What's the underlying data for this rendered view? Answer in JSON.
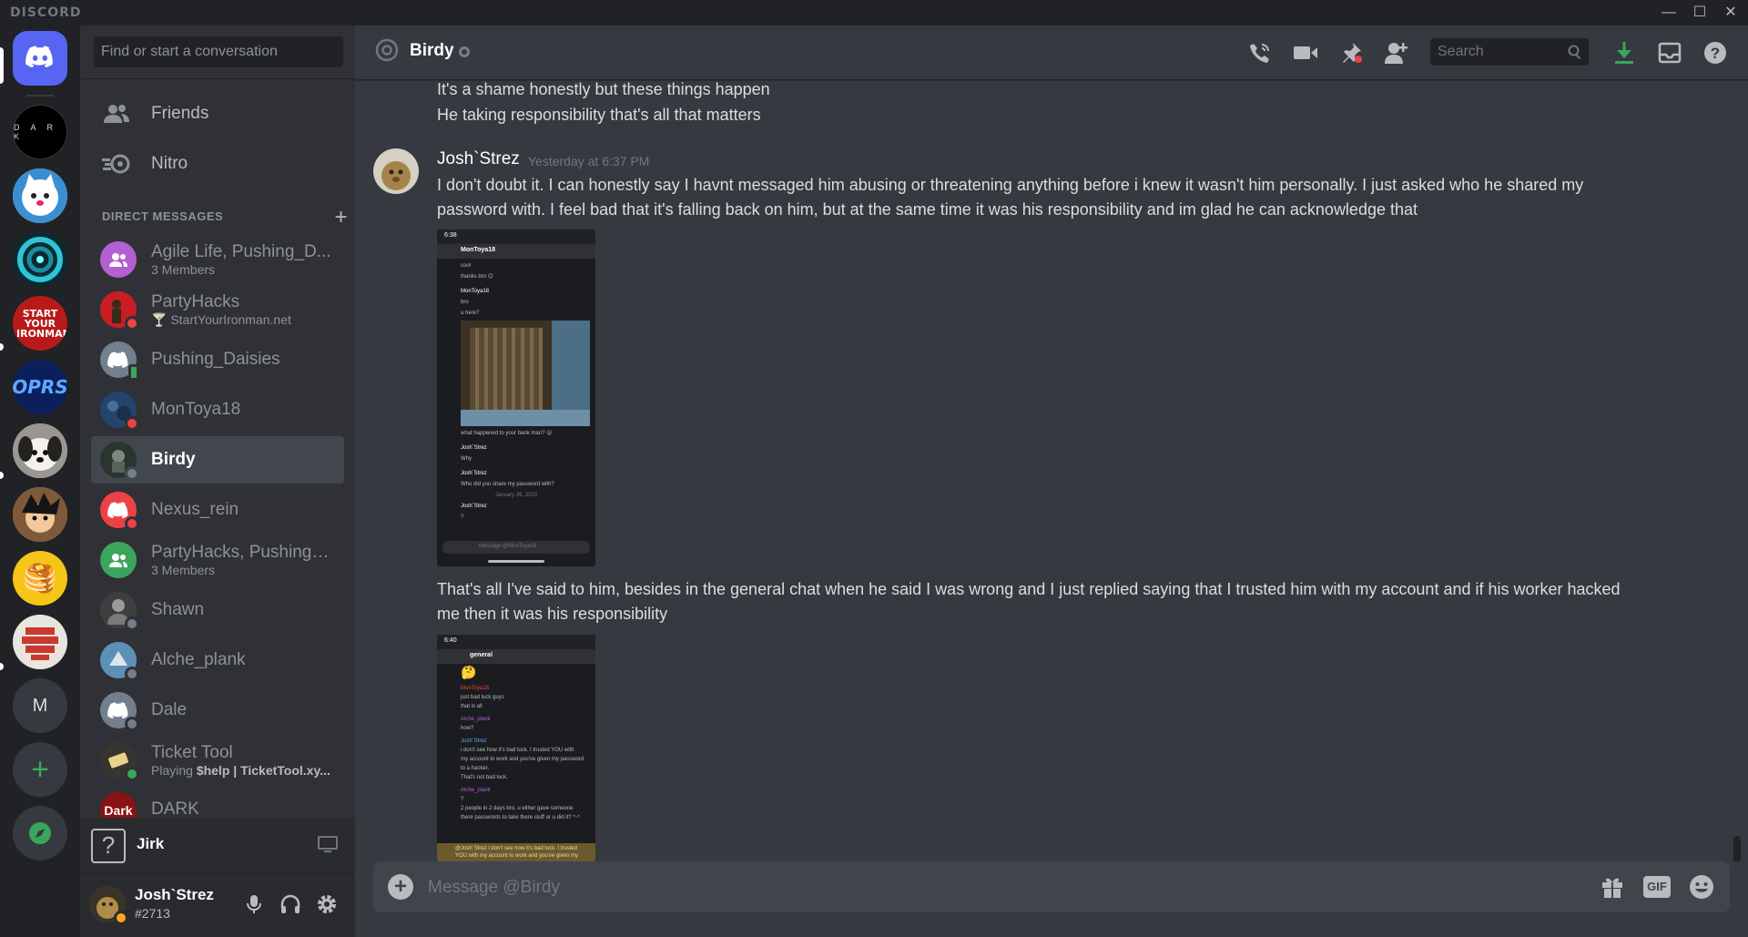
{
  "window": {
    "brand": "DISCORD",
    "minimize": "—",
    "maximize": "☐",
    "close": "✕"
  },
  "guilds": [
    {
      "name": "Home",
      "color": "#5865f2"
    },
    {
      "name": "DARK",
      "label": "D A R K",
      "color": "#000000"
    },
    {
      "name": "Cat server",
      "color": "#e8e8e8"
    },
    {
      "name": "Vortex server",
      "color": "#0d7a8c"
    },
    {
      "name": "Start Your Ironman",
      "label": "START YOUR IRONMAN",
      "color": "#b81a1a"
    },
    {
      "name": "OPRS",
      "label": "OPRS",
      "color": "#0b1f5c"
    },
    {
      "name": "Dog server",
      "color": "#c9c3bb"
    },
    {
      "name": "Anime server",
      "color": "#e1a96b"
    },
    {
      "name": "Pancake server",
      "label": "🥞",
      "color": "#f5c518"
    },
    {
      "name": "Red server",
      "color": "#c8392e"
    },
    {
      "name": "M server",
      "label": "M",
      "color": "#36393f"
    },
    {
      "name": "Add a Server",
      "label": "+",
      "color": "#36393f"
    },
    {
      "name": "Explore",
      "color": "#36393f"
    }
  ],
  "sidebar": {
    "search_placeholder": "Find or start a conversation",
    "friends": "Friends",
    "nitro": "Nitro",
    "dm_header": "DIRECT MESSAGES",
    "dm_add": "+",
    "dms": [
      {
        "name": "Agile Life, Pushing_D...",
        "sub": "3 Members",
        "avatar": "#b45fd2",
        "status": ""
      },
      {
        "name": "PartyHacks",
        "sub": "StartYourIronman.net",
        "avatar": "#c81d25",
        "status": "#ed4245"
      },
      {
        "name": "Pushing_Daisies",
        "sub": "",
        "avatar": "#747f8d",
        "status": "#3ba55d"
      },
      {
        "name": "MonToya18",
        "sub": "",
        "avatar": "#24446e",
        "status": "#ed4245"
      },
      {
        "name": "Birdy",
        "sub": "",
        "avatar": "#3b4a3e",
        "status": "#747f8d"
      },
      {
        "name": "Nexus_rein",
        "sub": "",
        "avatar": "#ed4245",
        "status": "#ed4245"
      },
      {
        "name": "PartyHacks, Pushing_...",
        "sub": "3 Members",
        "avatar": "#3ba55d",
        "status": ""
      },
      {
        "name": "Shawn",
        "sub": "",
        "avatar": "#5c5c5c",
        "status": "#747f8d"
      },
      {
        "name": "Alche_plank",
        "sub": "",
        "avatar": "#4f7da1",
        "status": "#747f8d"
      },
      {
        "name": "Dale",
        "sub": "",
        "avatar": "#747f8d",
        "status": "#747f8d"
      },
      {
        "name": "Ticket Tool",
        "sub_prefix": "Playing ",
        "sub_bold": "$help | TicketTool.xy...",
        "avatar": "#38352e",
        "status": "#3ba55d"
      },
      {
        "name": "DARK",
        "sub": "",
        "avatar_label": "Dark",
        "avatar": "#8a1212",
        "status": ""
      }
    ],
    "voice_user": "Jirk",
    "user": {
      "name": "Josh`Strez",
      "tag": "#2713"
    }
  },
  "header": {
    "channel": "Birdy",
    "search_placeholder": "Search"
  },
  "messages": {
    "line_a": "It's a shame honestly but these things happen",
    "line_b": "He taking responsibility that's all that matters",
    "author": "Josh`Strez",
    "timestamp": "Yesterday at 6:37 PM",
    "text_1a": "I don't doubt it. I can honestly say I havnt messaged him abusing or threatening anything before i knew it wasn't him personally. I just asked who he shared my",
    "text_1b": "password with. I feel bad that it's falling back on him, but at the same time it was his responsibility and im glad he can acknowledge that",
    "text_2a": "That's all I've said to him, besides in the general chat when he said I was wrong and I just replied saying that I trusted him with my account and if his worker hacked",
    "text_2b": "me then it was his responsibility",
    "shot1": {
      "clock": "6:38",
      "title": "MonToya18",
      "row1": "cool",
      "row2": "thanks bro 😊",
      "row3_name": "MonToya18",
      "row3_text": "bro",
      "row4": "u here?",
      "row5": "what happened to your bank man? 😮",
      "row6_name": "Josh`Strez",
      "row6_text": "Why",
      "row7_name": "Josh`Strez",
      "row7_text": "Who did you share my password with?",
      "divider": "January 26, 2020",
      "row8_name": "Josh`Strez",
      "row8_text": "?",
      "input": "Message @MonToya18"
    },
    "shot2": {
      "clock": "6:40",
      "title": "general",
      "emoji": "🤔",
      "r1_name": "MonToya18",
      "r1_text": "just bad luck guys",
      "r1_text2": "that is all",
      "r2_name": "Alche_plank",
      "r2_text": "how?",
      "r3_name": "Josh`Strez",
      "r3_text": "i don't see how it's bad luck. I trusted YOU with",
      "r3_text2": "my account to work and you've given my password",
      "r3_text3": "to a hacker.",
      "r3_text4": "That's not bad luck.",
      "r4_name": "Alche_plank",
      "r4_text": "?",
      "r5_text": "2 people in 2 days bro, u either gave someone",
      "r5_text2": "there passwords to take there stuff or u did it? ^-^",
      "r6_text": "@Josh`Strez i don't see how it's bad luck. I trusted",
      "r6_text2": "YOU with my account to work and you've given my"
    }
  },
  "composer": {
    "placeholder": "Message @Birdy",
    "gif": "GIF"
  },
  "colors": {
    "blurple": "#5865f2",
    "online": "#3ba55d",
    "dnd": "#ed4245",
    "offline": "#747f8d",
    "download": "#3ba55d"
  }
}
